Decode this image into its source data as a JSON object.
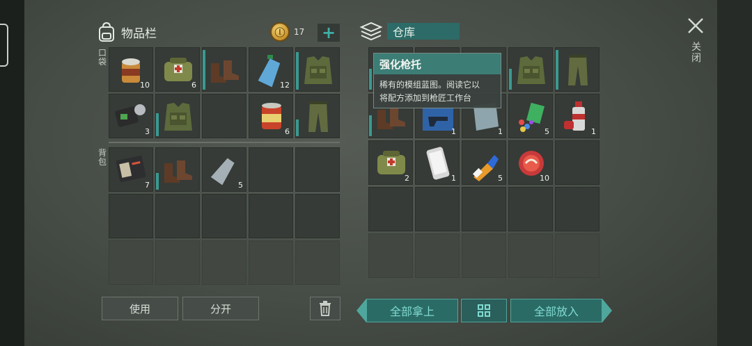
{
  "inventory": {
    "title": "物品栏",
    "coins": "17",
    "plus_label": "+",
    "pockets_label": "口袋",
    "backpack_label": "背包",
    "pockets": [
      {
        "item": "canned-food-open",
        "qty": "10",
        "bar": 0
      },
      {
        "item": "medkit-bag",
        "qty": "6",
        "bar": 0
      },
      {
        "item": "boots",
        "qty": "",
        "bar": 0.95
      },
      {
        "item": "water-bottle",
        "qty": "12",
        "bar": 0
      },
      {
        "item": "camo-vest",
        "qty": "",
        "bar": 0.9
      },
      {
        "item": "wallet-badge",
        "qty": "3",
        "bar": 0
      },
      {
        "item": "camo-vest",
        "qty": "",
        "bar": 0.55
      },
      {
        "item": "",
        "qty": "",
        "bar": 0
      },
      {
        "item": "food-can",
        "qty": "6",
        "bar": 0
      },
      {
        "item": "camo-pants",
        "qty": "",
        "bar": 0.4
      }
    ],
    "backpack": [
      {
        "item": "notebook",
        "qty": "7",
        "bar": 0
      },
      {
        "item": "boots",
        "qty": "",
        "bar": 0.4
      },
      {
        "item": "empty-bottle",
        "qty": "5",
        "bar": 0
      },
      {
        "item": "",
        "qty": "",
        "bar": 0
      },
      {
        "item": "",
        "qty": "",
        "bar": 0
      }
    ]
  },
  "storage": {
    "title": "仓库",
    "items": [
      {
        "item": "",
        "qty": "",
        "bar": 0.5
      },
      {
        "item": "",
        "qty": "",
        "bar": 0
      },
      {
        "item": "",
        "qty": "",
        "bar": 0
      },
      {
        "item": "camo-vest",
        "qty": "",
        "bar": 0.5
      },
      {
        "item": "camo-pants",
        "qty": "",
        "bar": 0.95
      },
      {
        "item": "boots",
        "qty": "",
        "bar": 0.5
      },
      {
        "item": "blueprint",
        "qty": "1",
        "bar": 0
      },
      {
        "item": "glass-shard",
        "qty": "1",
        "bar": 0
      },
      {
        "item": "gems-cards",
        "qty": "5",
        "bar": 0
      },
      {
        "item": "spray-can",
        "qty": "1",
        "bar": 0
      },
      {
        "item": "medkit-bag",
        "qty": "2",
        "bar": 0
      },
      {
        "item": "smartphone",
        "qty": "1",
        "bar": 0
      },
      {
        "item": "glue-tube",
        "qty": "5",
        "bar": 0
      },
      {
        "item": "bottle-caps",
        "qty": "10",
        "bar": 0
      },
      {
        "item": "",
        "qty": "",
        "bar": 0
      }
    ]
  },
  "tooltip": {
    "title": "强化枪托",
    "line1": "稀有的模组蓝图。阅读它以",
    "line2": "将配方添加到枪匠工作台"
  },
  "close_label": "关闭",
  "buttons": {
    "use": "使用",
    "split": "分开",
    "take_all": "全部拿上",
    "put_all": "全部放入"
  },
  "icons": {
    "inventory": "backpack-icon",
    "coin": "coin-icon",
    "storage": "storage-stack-icon",
    "close": "close-icon",
    "trash": "trash-icon",
    "grid": "grid-view-icon"
  }
}
